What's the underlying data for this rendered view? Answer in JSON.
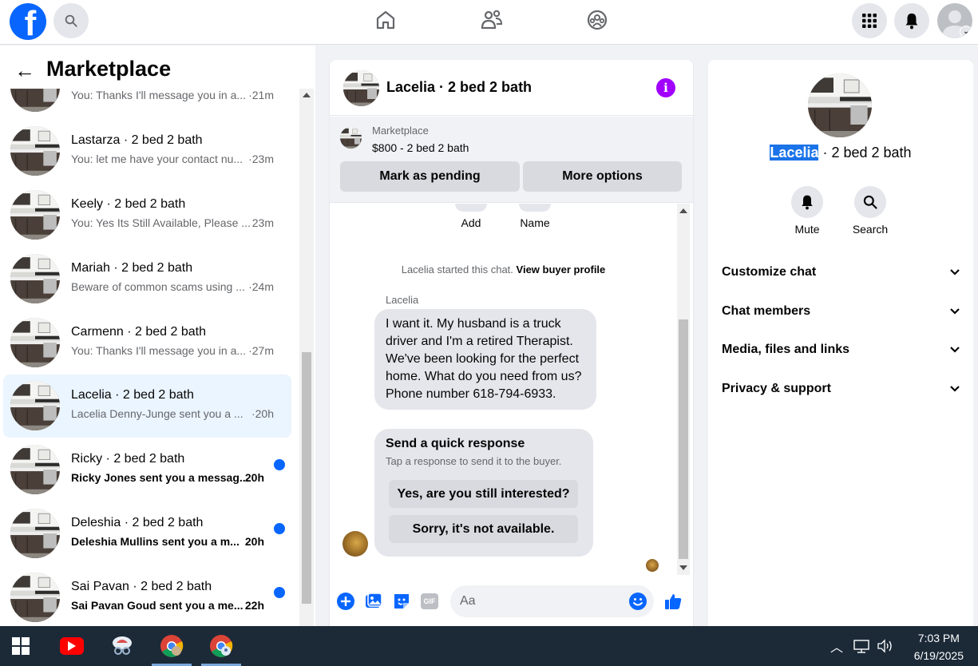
{
  "topbar": {
    "logo_letter": "f",
    "brand_color": "#0866ff"
  },
  "left_panel": {
    "title": "Marketplace",
    "conversations": [
      {
        "name": "",
        "preview": "You: Thanks I'll message you in a...",
        "time": "·21m",
        "unread": false
      },
      {
        "name": "Lastarza · 2 bed 2 bath",
        "preview": "You: let me have your contact nu...",
        "time": "·23m",
        "unread": false
      },
      {
        "name": "Keely · 2 bed 2 bath",
        "preview": "You: Yes Its Still Available, Please ...",
        "time": "23m",
        "unread": false
      },
      {
        "name": "Mariah · 2 bed 2 bath",
        "preview": "Beware of common scams using ...",
        "time": "·24m",
        "unread": false
      },
      {
        "name": "Carmenn · 2 bed 2 bath",
        "preview": "You: Thanks I'll message you in a...",
        "time": "·27m",
        "unread": false
      },
      {
        "name": "Lacelia · 2 bed 2 bath",
        "preview": "Lacelia Denny-Junge sent you a ...",
        "time": "·20h",
        "unread": false,
        "active": true
      },
      {
        "name": "Ricky · 2 bed 2 bath",
        "preview": "Ricky Jones sent you a messag...",
        "time": "20h",
        "unread": true
      },
      {
        "name": "Deleshia · 2 bed 2 bath",
        "preview": "Deleshia Mullins sent you a m...",
        "time": "20h",
        "unread": true
      },
      {
        "name": "Sai Pavan · 2 bed 2 bath",
        "preview": "Sai Pavan Goud sent you a me...",
        "time": "22h",
        "unread": true
      }
    ]
  },
  "chat": {
    "title": "Lacelia · 2 bed 2 bath",
    "listing_source": "Marketplace",
    "listing_price": "$800 - 2 bed 2 bath",
    "mark_pending_label": "Mark as pending",
    "more_options_label": "More options",
    "actions": [
      "Add",
      "Name"
    ],
    "system_message_prefix": "Lacelia started this chat. ",
    "system_message_link": "View buyer profile",
    "sender_name": "Lacelia",
    "message_text": "I want it. My husband is a truck driver and I'm a retired Therapist. We've been looking for the perfect home. What do you need from us? Phone number 618-794-6933.",
    "quick_response_title": "Send a quick response",
    "quick_response_subtitle": "Tap a response to send it to the buyer.",
    "quick_replies": [
      "Yes, are you still interested?",
      "Sorry, it's not available."
    ],
    "input_placeholder": "Aa",
    "gif_label": "GIF"
  },
  "right_panel": {
    "name_highlighted": "Lacelia",
    "name_rest": " · 2 bed 2 bath",
    "mute_label": "Mute",
    "search_label": "Search",
    "menu": [
      "Customize chat",
      "Chat members",
      "Media, files and links",
      "Privacy & support"
    ]
  },
  "taskbar": {
    "time": "7:03 PM",
    "date": "6/19/2025"
  }
}
